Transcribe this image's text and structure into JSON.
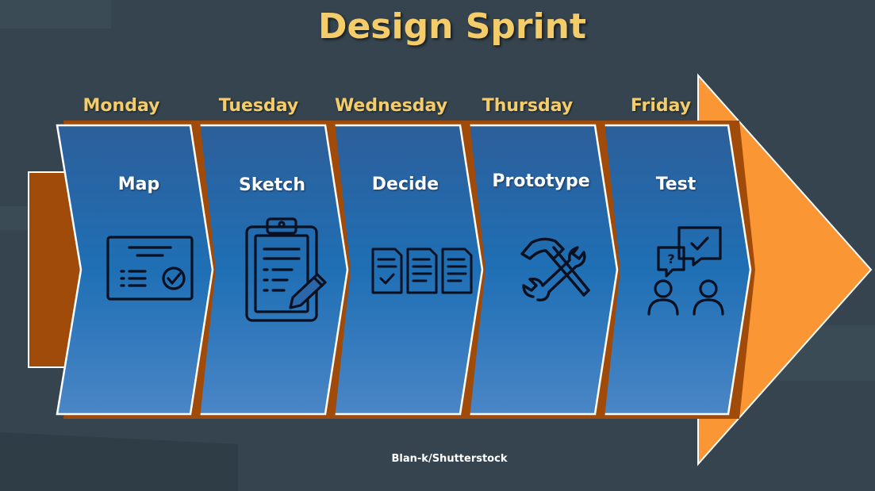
{
  "title": "Design Sprint",
  "credit": "Blan-k/Shutterstock",
  "colors": {
    "background": "#35444f",
    "title": "#f4cd6a",
    "arrow_orange": "#fb9635",
    "tail_brown": "#a04b0a",
    "chevron_top": "#2d5f9a",
    "chevron_bottom": "#4a86c6"
  },
  "stages": [
    {
      "day": "Monday",
      "label": "Map",
      "icon": "certificate-checkmark-icon"
    },
    {
      "day": "Tuesday",
      "label": "Sketch",
      "icon": "clipboard-pen-icon"
    },
    {
      "day": "Wednesday",
      "label": "Decide",
      "icon": "documents-check-icon"
    },
    {
      "day": "Thursday",
      "label": "Prototype",
      "icon": "hammer-wrench-icon"
    },
    {
      "day": "Friday",
      "label": "Test",
      "icon": "users-feedback-icon"
    }
  ]
}
